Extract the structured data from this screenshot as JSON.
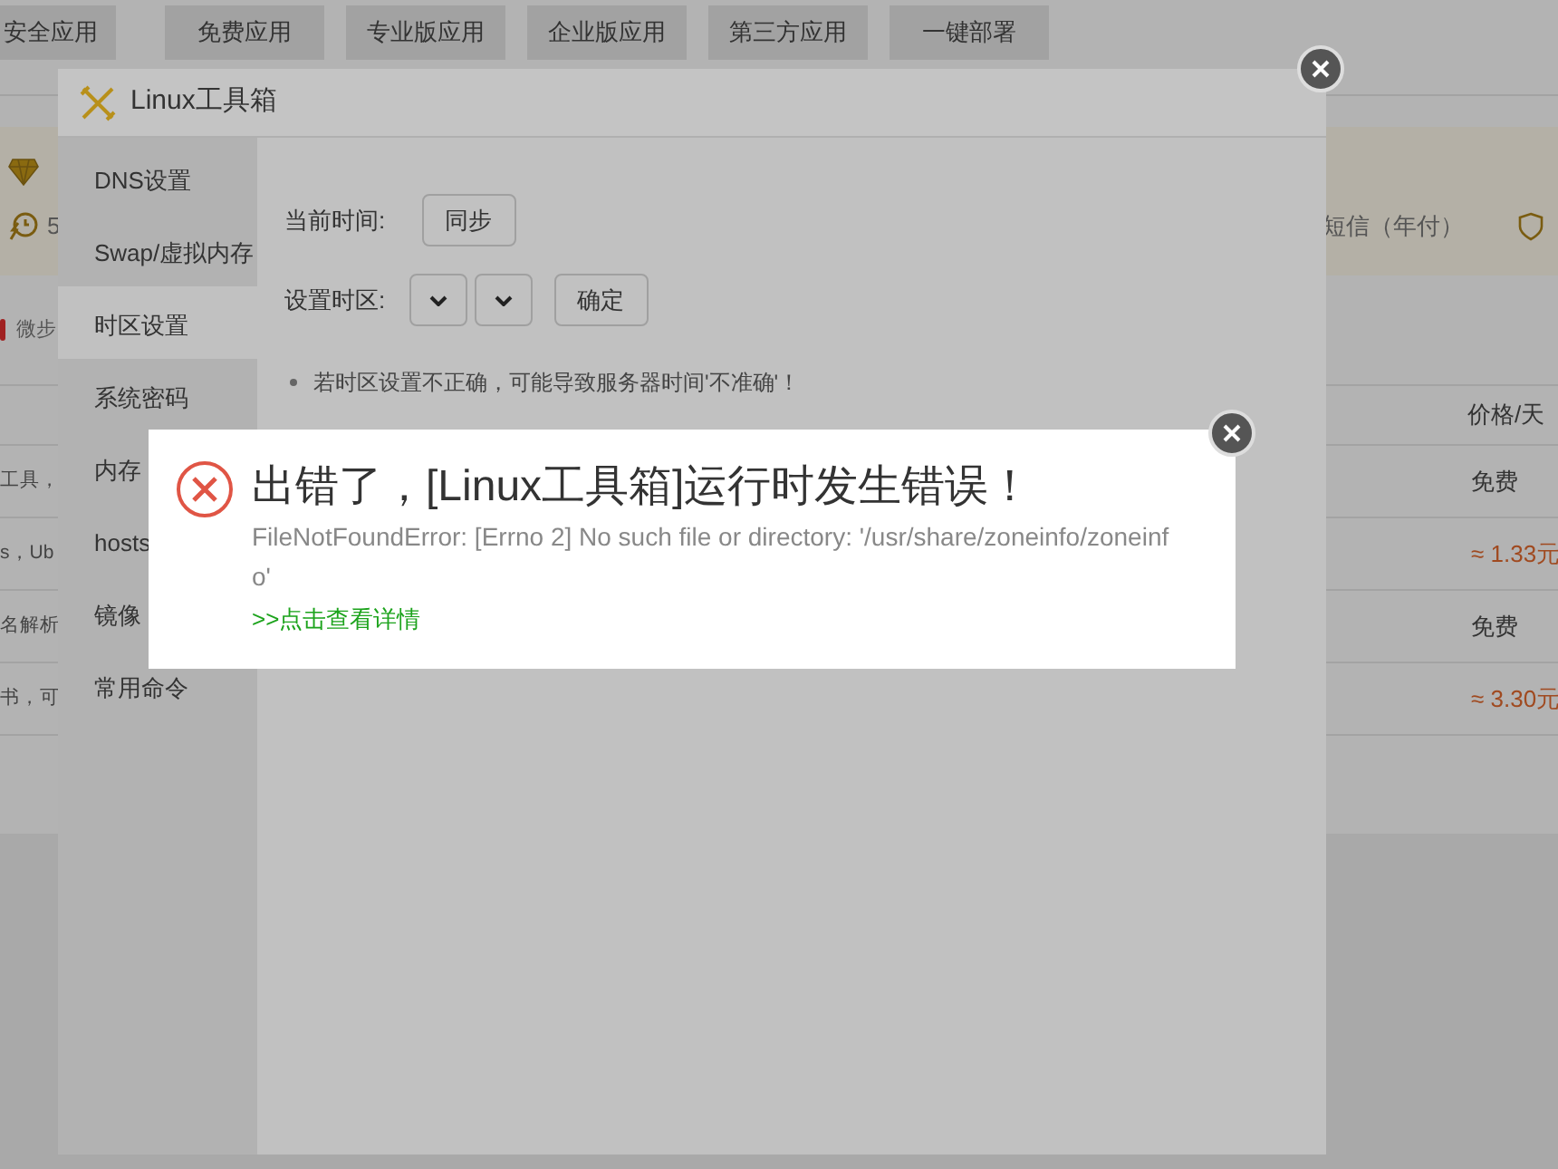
{
  "background_page": {
    "tabs": [
      "安全应用",
      "免费应用",
      "专业版应用",
      "企业版应用",
      "第三方应用",
      "一键部署"
    ],
    "banner": {
      "left_text": "5",
      "right_text": "短信（年付）"
    },
    "filter_label": "微步",
    "table": {
      "price_header": "价格/天",
      "rows": [
        {
          "name": "工具，",
          "price": "免费",
          "kind": "free"
        },
        {
          "name": "s，Ub",
          "price": "≈ 1.33元",
          "kind": "paid"
        },
        {
          "name": "名解析",
          "price": "免费",
          "kind": "free"
        },
        {
          "name": "书，可",
          "price": "≈ 3.30元",
          "kind": "paid"
        }
      ]
    }
  },
  "tool_window": {
    "title": "Linux工具箱",
    "sidebar": [
      {
        "label": "DNS设置",
        "selected": false
      },
      {
        "label": "Swap/虚拟内存",
        "selected": false
      },
      {
        "label": "时区设置",
        "selected": true
      },
      {
        "label": "系统密码",
        "selected": false
      },
      {
        "label": "内存",
        "selected": false
      },
      {
        "label": "hosts",
        "selected": false
      },
      {
        "label": "镜像",
        "selected": false
      },
      {
        "label": "常用命令",
        "selected": false
      }
    ],
    "current_time_label": "当前时间:",
    "sync_button": "同步",
    "timezone_label": "设置时区:",
    "confirm_button": "确定",
    "notes": [
      "若时区设置不正确，可能导致服务器时间'不准确'！"
    ]
  },
  "error_dialog": {
    "title": "出错了，[Linux工具箱]运行时发生错误！",
    "message": "FileNotFoundError: [Errno 2] No such file or directory: '/usr/share/zoneinfo/zoneinfo'",
    "details_link": ">>点击查看详情"
  }
}
